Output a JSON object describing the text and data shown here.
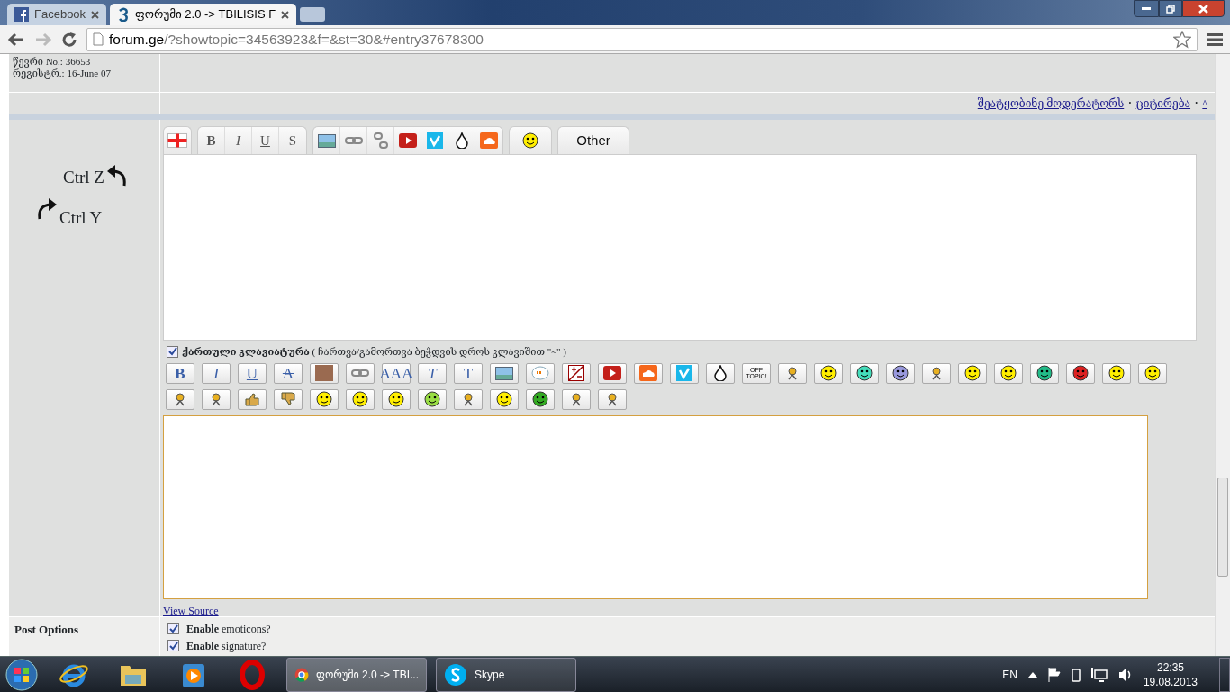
{
  "browser": {
    "tabs": [
      {
        "title": "Facebook",
        "kind": "facebook",
        "selected": false
      },
      {
        "title": "ფორუმი 2.0 -> TBILISIS F",
        "kind": "forum",
        "selected": true
      }
    ],
    "address": {
      "host": "forum.ge",
      "path": "/?showtopic=34563923&f=&st=30&#entry37678300"
    }
  },
  "post": {
    "author_info": [
      "წევრი No.: 36653",
      "რეგისტრ.: 16-June 07"
    ],
    "links": [
      "შეატყობინე მოდერატორს",
      "ციტირება",
      "^"
    ],
    "separator": "·"
  },
  "editor": {
    "undo": "Ctrl Z",
    "redo": "Ctrl Y",
    "toolbar_groups": [
      {
        "buttons": [
          {
            "kind": "flag"
          }
        ]
      },
      {
        "buttons": [
          {
            "kind": "bold",
            "label": "B"
          },
          {
            "kind": "italic",
            "label": "I"
          },
          {
            "kind": "underline",
            "label": "U"
          },
          {
            "kind": "strike",
            "label": "S"
          }
        ]
      },
      {
        "buttons": [
          {
            "kind": "picture"
          },
          {
            "kind": "link"
          },
          {
            "kind": "unlink"
          },
          {
            "kind": "youtube"
          },
          {
            "kind": "vimeo"
          },
          {
            "kind": "drop"
          },
          {
            "kind": "soundcloud"
          }
        ]
      },
      {
        "buttons": [
          {
            "kind": "smiley",
            "color": "#ffee00"
          }
        ]
      },
      {
        "buttons": [
          {
            "kind": "text",
            "label": "Other"
          }
        ]
      }
    ],
    "keyboard": {
      "checked": true,
      "text": "**ქართული კლავიატურა** ( ჩართვა/გამორთვა ბეჭდვის დროს კლავიშით \"~\" )"
    },
    "quick_rows": [
      [
        {
          "kind": "bold",
          "label": "B"
        },
        {
          "kind": "italic",
          "label": "I"
        },
        {
          "kind": "underline",
          "label": "U"
        },
        {
          "kind": "strike",
          "label": "A"
        },
        {
          "kind": "photo"
        },
        {
          "kind": "link"
        },
        {
          "kind": "plain",
          "label": "AAA"
        },
        {
          "kind": "italic",
          "label": "T"
        },
        {
          "kind": "plain",
          "label": "T"
        },
        {
          "kind": "picture"
        },
        {
          "kind": "quote"
        },
        {
          "kind": "plusminus"
        },
        {
          "kind": "youtube"
        },
        {
          "kind": "soundcloud"
        },
        {
          "kind": "vimeo"
        },
        {
          "kind": "drop"
        },
        {
          "kind": "small",
          "label": "OFF TOPIC!"
        },
        {
          "kind": "figure"
        },
        {
          "kind": "smiley",
          "color": "#ffee00"
        },
        {
          "kind": "smiley",
          "color": "#44ddbb"
        },
        {
          "kind": "smiley",
          "color": "#9999dd"
        },
        {
          "kind": "figure"
        },
        {
          "kind": "smiley",
          "color": "#ffee00"
        },
        {
          "kind": "smiley",
          "color": "#ffee00"
        },
        {
          "kind": "smiley",
          "color": "#22bb88"
        },
        {
          "kind": "smiley",
          "color": "#dd2222"
        },
        {
          "kind": "smiley",
          "color": "#ffee00"
        },
        {
          "kind": "smiley",
          "color": "#ffee00"
        }
      ],
      [
        {
          "kind": "figure"
        },
        {
          "kind": "figure"
        },
        {
          "kind": "thumb-up"
        },
        {
          "kind": "thumb-down"
        },
        {
          "kind": "smiley",
          "color": "#ffee00"
        },
        {
          "kind": "smiley",
          "color": "#ffee00"
        },
        {
          "kind": "smiley",
          "color": "#ffee00"
        },
        {
          "kind": "smiley",
          "color": "#99dd44"
        },
        {
          "kind": "figure"
        },
        {
          "kind": "smiley",
          "color": "#ffee00"
        },
        {
          "kind": "smiley",
          "color": "#33aa22"
        },
        {
          "kind": "figure"
        },
        {
          "kind": "figure"
        }
      ]
    ],
    "view_source": "View Source"
  },
  "post_options": {
    "label": "Post Options",
    "options": [
      {
        "text": "**Enable** emoticons?",
        "checked": true
      },
      {
        "text": "**Enable** signature?",
        "checked": true
      }
    ]
  },
  "taskbar": {
    "pinned": [
      {
        "kind": "ie"
      },
      {
        "kind": "folder"
      },
      {
        "kind": "player"
      },
      {
        "kind": "opera"
      }
    ],
    "windows": [
      {
        "kind": "chrome",
        "label": "ფორუმი 2.0 -> TBI...",
        "selected": true
      },
      {
        "kind": "skype",
        "label": "Skype",
        "selected": false
      }
    ],
    "language": "EN",
    "time": "22:35",
    "date": "19.08.2013"
  }
}
